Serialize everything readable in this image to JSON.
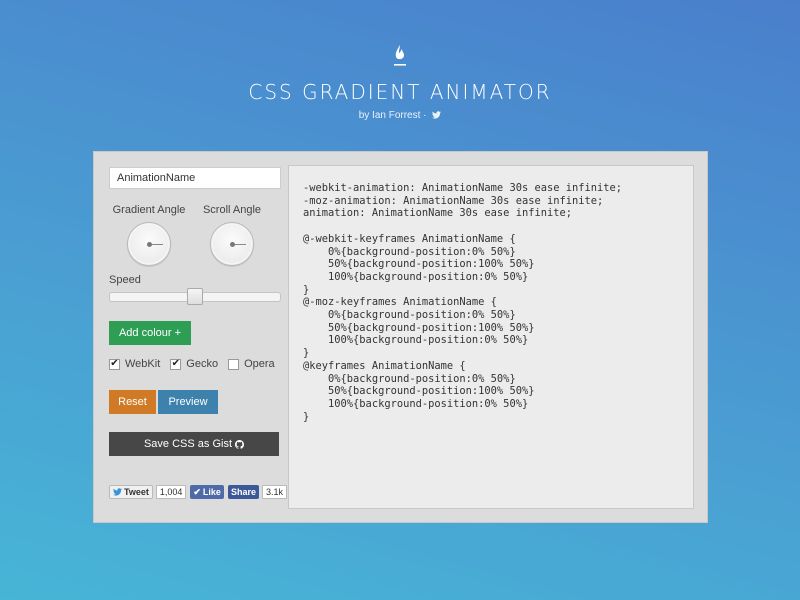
{
  "header": {
    "title": "CSS GRADIENT ANIMATOR",
    "byline": "by Ian Forrest ·",
    "logo_icon": "flame-icon",
    "twitter_icon": "twitter-bird-icon"
  },
  "controls": {
    "animation_name_value": "AnimationName",
    "gradient_angle_label": "Gradient Angle",
    "scroll_angle_label": "Scroll Angle",
    "speed_label": "Speed",
    "speed_level": 0.5,
    "add_colour_label": "Add colour +",
    "checkboxes": [
      {
        "label": "WebKit",
        "checked": true
      },
      {
        "label": "Gecko",
        "checked": true
      },
      {
        "label": "Opera",
        "checked": false
      }
    ],
    "reset_label": "Reset",
    "preview_label": "Preview",
    "save_gist_label": "Save CSS as Gist"
  },
  "social": {
    "tweet_label": "Tweet",
    "tweet_count": "1,004",
    "like_label": "Like",
    "share_label": "Share",
    "share_count": "3.1k"
  },
  "code_output": "-webkit-animation: AnimationName 30s ease infinite;\n-moz-animation: AnimationName 30s ease infinite;\nanimation: AnimationName 30s ease infinite;\n\n@-webkit-keyframes AnimationName {\n    0%{background-position:0% 50%}\n    50%{background-position:100% 50%}\n    100%{background-position:0% 50%}\n}\n@-moz-keyframes AnimationName {\n    0%{background-position:0% 50%}\n    50%{background-position:100% 50%}\n    100%{background-position:0% 50%}\n}\n@keyframes AnimationName {\n    0%{background-position:0% 50%}\n    50%{background-position:100% 50%}\n    100%{background-position:0% 50%}\n}",
  "colors": {
    "add_colour": "#2f9e55",
    "reset": "#d17a25",
    "preview": "#3d82ad",
    "gist": "#474747"
  }
}
